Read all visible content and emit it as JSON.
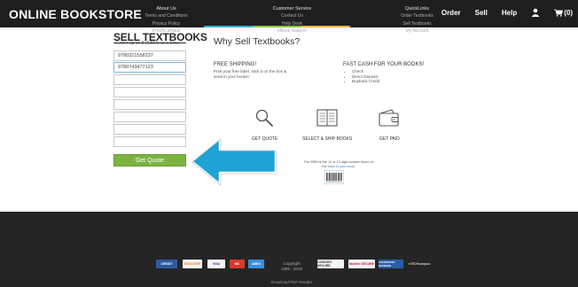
{
  "header": {
    "brand": "ONLINE BOOKSTORE",
    "nav": [
      "Order",
      "Sell",
      "Help"
    ],
    "cart_count": "(0)",
    "accent_colors": [
      "#3aa9d8",
      "#8bc34a",
      "#f0ad4e"
    ]
  },
  "sell_form": {
    "title": "SELL TEXTBOOKS",
    "subtitle": "Enter up to 8 ISBNs at a time",
    "isbns": [
      "9780321558237",
      "9780743477123",
      "",
      "",
      "",
      "",
      "",
      ""
    ],
    "quote_button": "Get Quote",
    "button_color": "#7cb342"
  },
  "why": {
    "title": "Why Sell Textbooks?",
    "free_shipping_title": "FREE SHIPPING!",
    "free_shipping_text": "Print your free label, stick it on the box & send in your books!",
    "fast_cash_title": "FAST CASH FOR YOUR BOOKS!",
    "fast_cash_items": [
      "Check",
      "Direct Deposit",
      "Buyback Credit"
    ]
  },
  "steps": [
    {
      "label": "GET QUOTE",
      "icon": "magnifier-icon"
    },
    {
      "label": "SELECT & SHIP BOOKS",
      "icon": "book-icon"
    },
    {
      "label": "GET PAID",
      "icon": "wallet-icon"
    }
  ],
  "isbn_note": {
    "text_before": "The ISBN is the 10 or 13 digit number found on the",
    "link": "back of your book",
    "text_after": "."
  },
  "arrow_color": "#1fa3d4",
  "footer": {
    "about": {
      "head": "About Us",
      "links": [
        "Terms and Conditions",
        "Privacy Policy",
        "eTechCampus"
      ]
    },
    "service": {
      "head": "Customer Service",
      "links": [
        "Contact Us",
        "Help Desk",
        "eBook Support"
      ]
    },
    "quick": {
      "head": "QuickLinks",
      "links": [
        "Order Textbooks",
        "Sell Textbooks",
        "My Account"
      ]
    },
    "copyright": [
      "Copyright",
      "1995 - 2018"
    ],
    "pdf_reader": "Download PDF Reader",
    "badges": [
      "CREDIT",
      "DISCOVER",
      "VISA",
      "MC",
      "AMEX",
      "COMODO SECURE",
      "McAfee SECURE",
      "ACCREDITED BUSINESS",
      "eTECHcampus"
    ]
  }
}
